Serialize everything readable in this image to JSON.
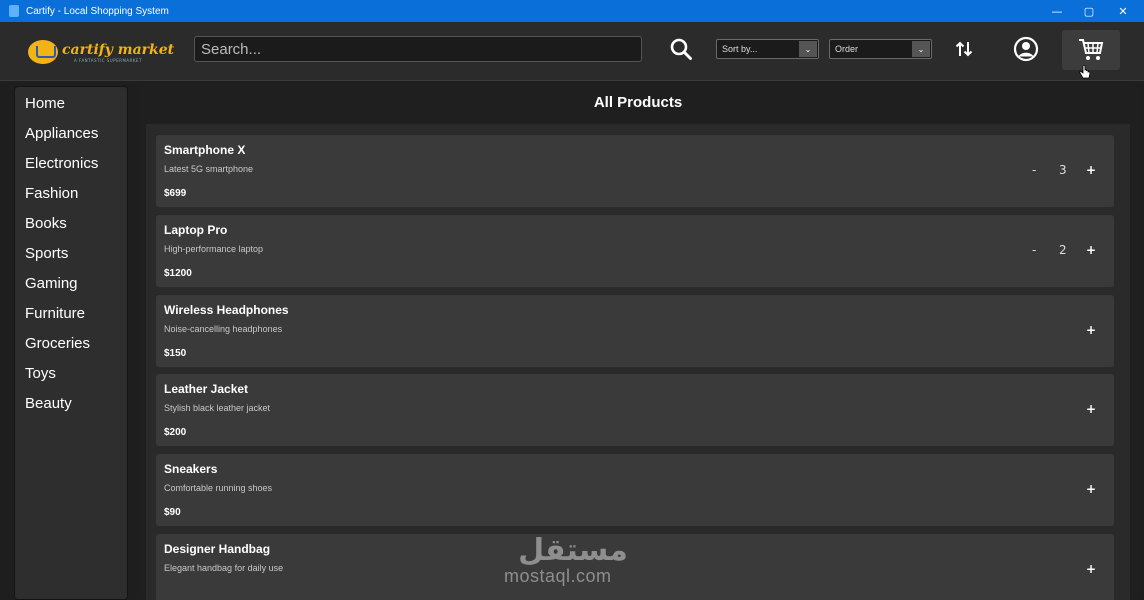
{
  "window": {
    "title": "Cartify - Local Shopping System",
    "controls": [
      "—",
      "▢",
      "✕"
    ]
  },
  "header": {
    "logo_name": "cartify market",
    "logo_tagline": "A FANTASTIC SUPERMARKET",
    "search_placeholder": "Search...",
    "sort_label": "Sort by...",
    "order_label": "Order",
    "icons": [
      "search-icon",
      "sort-arrows-icon",
      "user-profile-icon",
      "cart-icon"
    ]
  },
  "sidebar": {
    "items": [
      "Home",
      "Appliances",
      "Electronics",
      "Fashion",
      "Books",
      "Sports",
      "Gaming",
      "Furniture",
      "Groceries",
      "Toys",
      "Beauty"
    ]
  },
  "main": {
    "title": "All Products",
    "products": [
      {
        "name": "Smartphone X",
        "description": "Latest 5G smartphone",
        "price": "$699",
        "minus": "-",
        "qty": "3",
        "plus": "+"
      },
      {
        "name": "Laptop Pro",
        "description": "High-performance laptop",
        "price": "$1200",
        "minus": "-",
        "qty": "2",
        "plus": "+"
      },
      {
        "name": "Wireless Headphones",
        "description": "Noise-cancelling headphones",
        "price": "$150",
        "minus": "",
        "qty": "",
        "plus": "+"
      },
      {
        "name": "Leather Jacket",
        "description": "Stylish black leather jacket",
        "price": "$200",
        "minus": "",
        "qty": "",
        "plus": "+"
      },
      {
        "name": "Sneakers",
        "description": "Comfortable running shoes",
        "price": "$90",
        "minus": "",
        "qty": "",
        "plus": "+"
      },
      {
        "name": "Designer Handbag",
        "description": "Elegant handbag for daily use",
        "price": "",
        "minus": "",
        "qty": "",
        "plus": "+"
      }
    ]
  },
  "watermark": {
    "arabic": "مستقل",
    "latin": "mostaql.com"
  },
  "colors": {
    "titlebar": "#0a6fd8",
    "background": "#1e1e1e",
    "card": "#3a3a3a",
    "logo_accent": "#f2b315"
  }
}
